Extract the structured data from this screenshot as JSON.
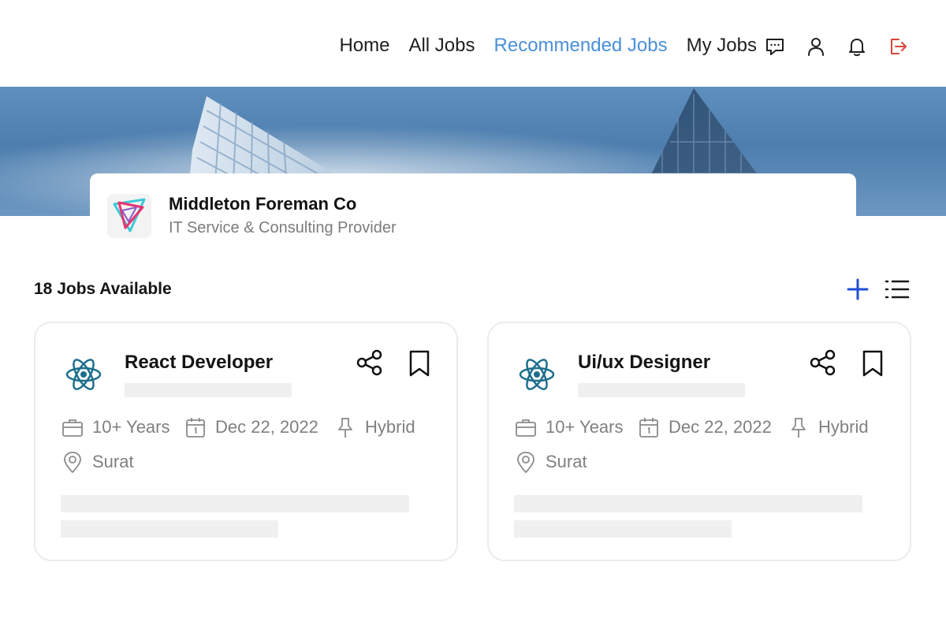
{
  "nav": {
    "links": [
      "Home",
      "All Jobs",
      "Recommended Jobs",
      "My Jobs"
    ],
    "active_link": "Recommended Jobs",
    "icons": [
      "chat-icon",
      "user-icon",
      "bell-icon",
      "logout-icon"
    ],
    "colors": {
      "active": "#4a90d9",
      "logout": "#d9463b"
    }
  },
  "company": {
    "name": "Middleton Foreman Co",
    "type": "IT Service & Consulting Provider"
  },
  "jobs_header": {
    "count_label": "18 Jobs Available",
    "add_icon": "plus-icon",
    "list_icon": "list-view-icon",
    "accent": "#1f4fd6"
  },
  "jobs": [
    {
      "title": "React Developer",
      "experience": "10+ Years",
      "date": "Dec 22, 2022",
      "mode": "Hybrid",
      "location": "Surat"
    },
    {
      "title": "Ui/ux Designer",
      "experience": "10+ Years",
      "date": "Dec 22, 2022",
      "mode": "Hybrid",
      "location": "Surat"
    }
  ]
}
